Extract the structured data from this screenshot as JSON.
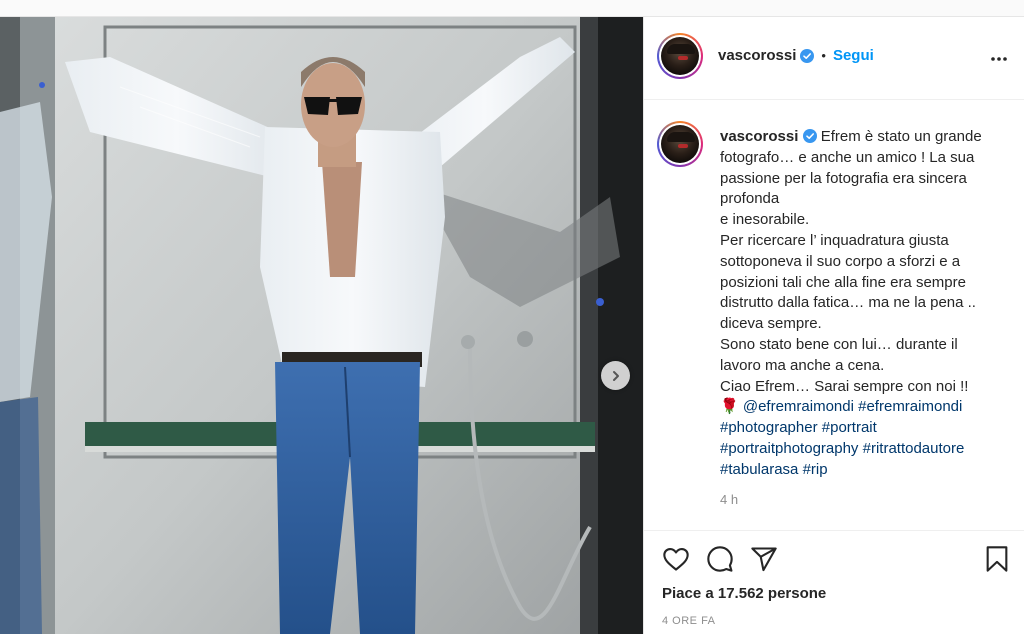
{
  "post": {
    "username": "vascorossi",
    "follow_label": "Segui",
    "separator": "•",
    "caption": {
      "username": "vascorossi",
      "lines": [
        "Efrem è stato un grande",
        "fotografo… e anche un amico ! La sua",
        "passione per la fotografia era sincera",
        "profonda",
        "e inesorabile.",
        "Per ricercare l’ inquadratura giusta",
        "sottoponeva il suo corpo a sforzi e a",
        "posizioni tali che alla fine era sempre",
        "distrutto dalla fatica… ma ne la pena ..",
        "diceva sempre.",
        "Sono stato bene con lui… durante il",
        "lavoro ma anche a cena.",
        "Ciao Efrem… Sarai sempre con noi !!"
      ],
      "emoji": "🌹",
      "mention": "@efremraimondi",
      "hashtags": {
        "h1": "#efremraimondi",
        "h2": "#photographer",
        "h3": "#portrait",
        "h4": "#portraitphotography",
        "h5": "#ritrattodautore",
        "h6": "#tabularasa",
        "h7": "#rip"
      }
    },
    "timestamp": "4 h",
    "likes_text": "Piace a 17.562 persone",
    "date_text": "4 ORE FA"
  },
  "icons": {
    "verified": "verified-badge-icon",
    "more": "more-options-icon",
    "like": "heart-icon",
    "comment": "comment-icon",
    "share": "share-icon",
    "save": "bookmark-icon",
    "next": "chevron-right-icon"
  },
  "colors": {
    "accent": "#0095f6",
    "link": "#00376b",
    "muted": "#8e8e8e",
    "text": "#262626"
  }
}
